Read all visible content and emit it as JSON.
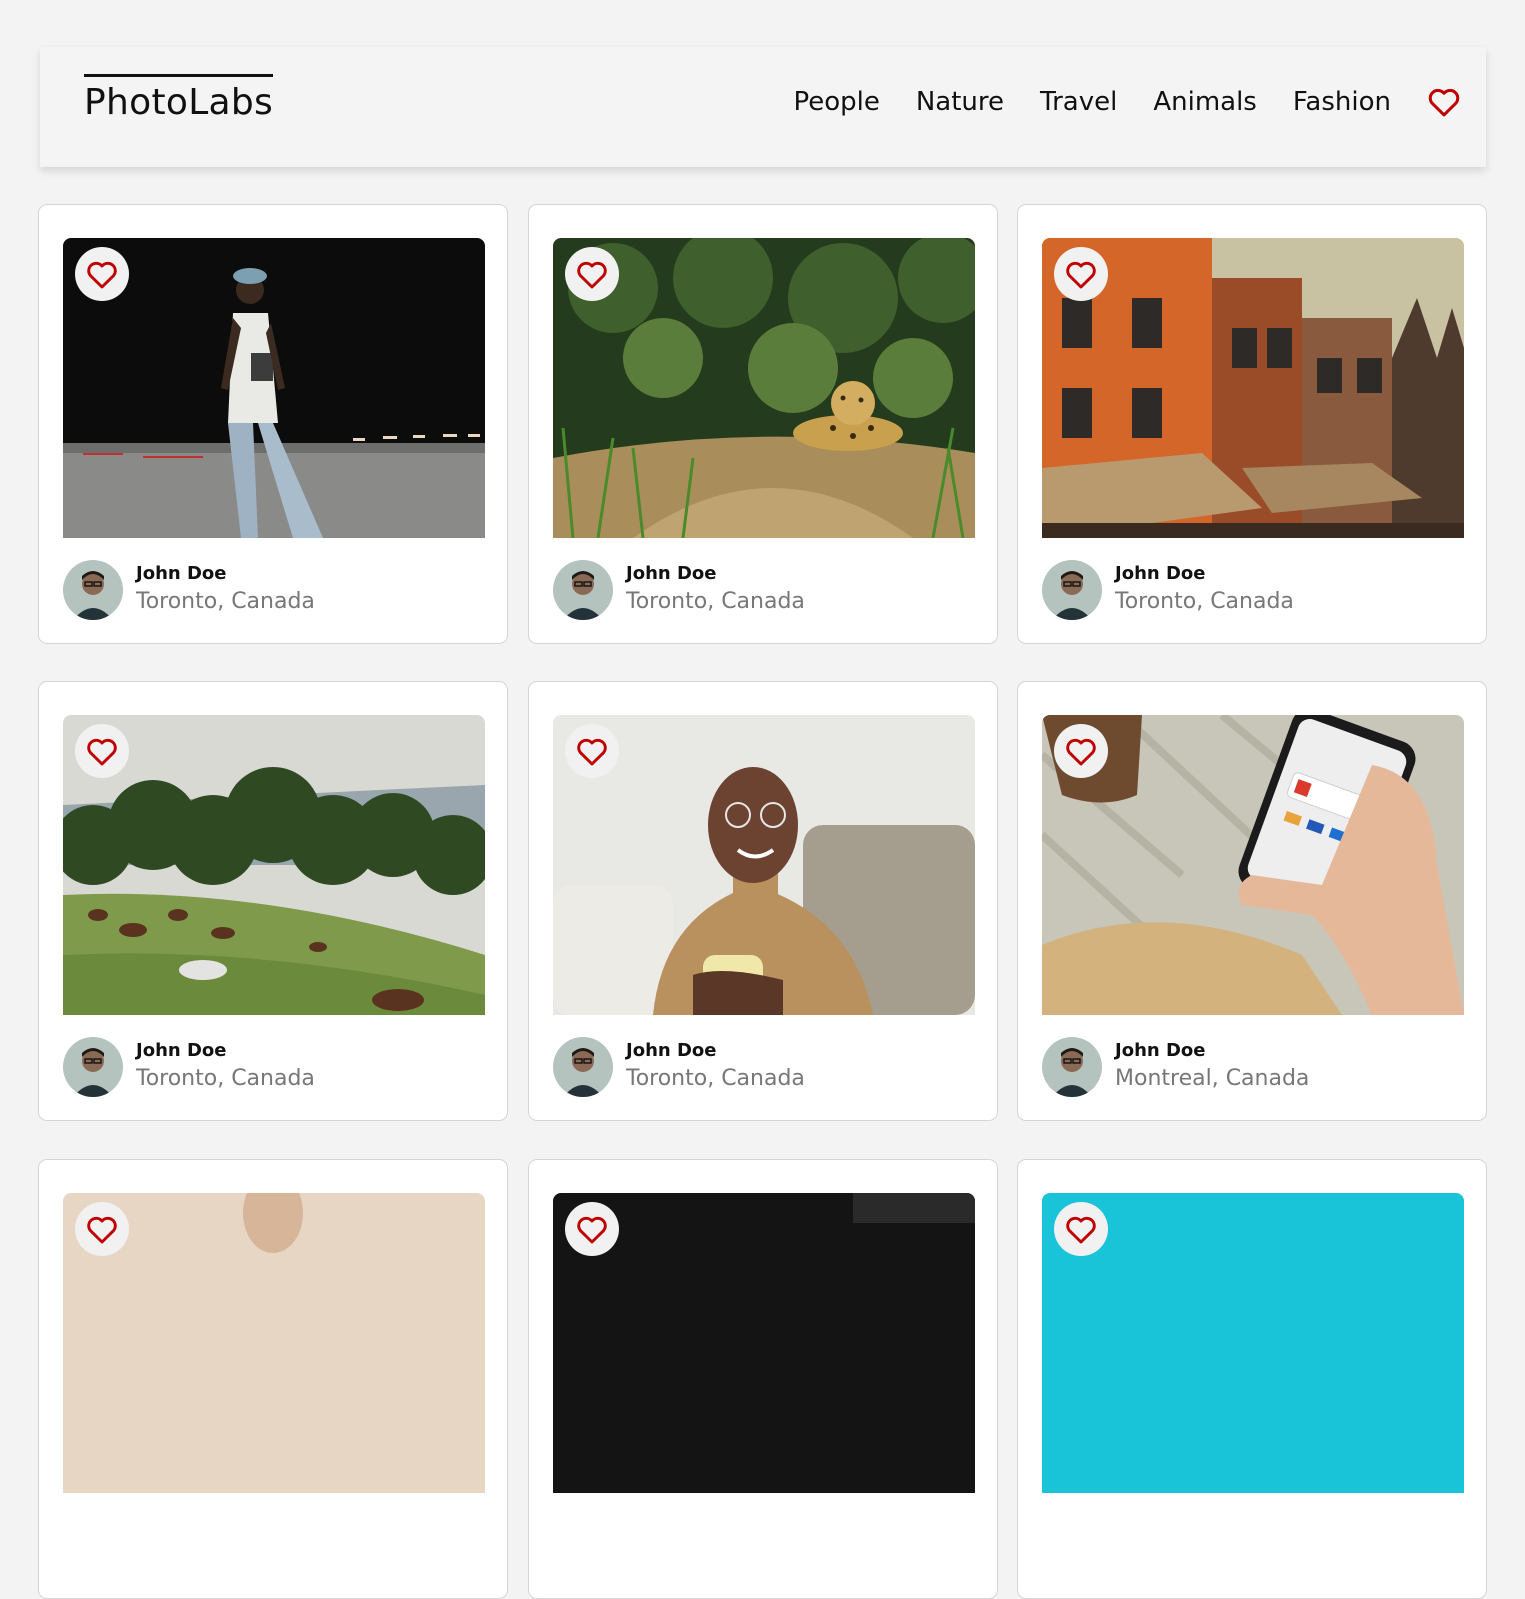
{
  "app": {
    "logo": "PhotoLabs"
  },
  "nav": {
    "items": [
      "People",
      "Nature",
      "Travel",
      "Animals",
      "Fashion"
    ],
    "favourites_icon": "heart-icon"
  },
  "colors": {
    "heart": "#c00000",
    "background": "#f3f3f3",
    "card": "#ffffff",
    "location_text": "#777777"
  },
  "photos": [
    {
      "user": "John Doe",
      "location": "Toronto, Canada",
      "scene": "man-walking-night"
    },
    {
      "user": "John Doe",
      "location": "Toronto, Canada",
      "scene": "jaguar-in-grass"
    },
    {
      "user": "John Doe",
      "location": "Toronto, Canada",
      "scene": "orange-buildings-street"
    },
    {
      "user": "John Doe",
      "location": "Toronto, Canada",
      "scene": "horses-on-hillside"
    },
    {
      "user": "John Doe",
      "location": "Toronto, Canada",
      "scene": "man-with-mug-on-sofa"
    },
    {
      "user": "John Doe",
      "location": "Montreal, Canada",
      "scene": "hand-holding-phone"
    },
    {
      "user": "",
      "location": "",
      "scene": "portrait-partial"
    },
    {
      "user": "",
      "location": "",
      "scene": "dark-partial"
    },
    {
      "user": "",
      "location": "",
      "scene": "cyan-partial"
    }
  ]
}
